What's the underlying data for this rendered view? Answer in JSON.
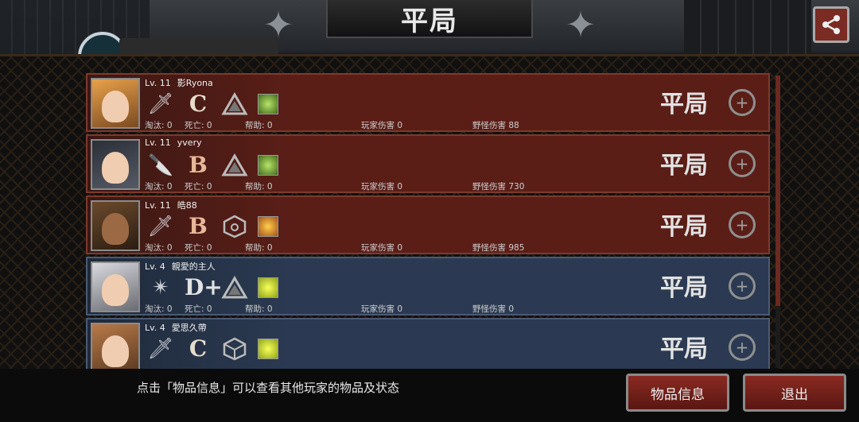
{
  "header": {
    "title": "平局"
  },
  "icons": {
    "share": "share-icon"
  },
  "players": [
    {
      "level": "Lv. 11",
      "name": "影Ryona",
      "weapon": "dagger",
      "grade": "C",
      "result": "平局",
      "eliminations": "淘汰: 0",
      "deaths": "死亡: 0",
      "assists": "帮助: 0",
      "player_damage": "玩家伤害 0",
      "monster_damage": "野怪伤害 88",
      "theme": "red"
    },
    {
      "level": "Lv. 11",
      "name": "yvery",
      "weapon": "knife",
      "grade": "B",
      "result": "平局",
      "eliminations": "淘汰: 0",
      "deaths": "死亡: 0",
      "assists": "帮助: 0",
      "player_damage": "玩家伤害 0",
      "monster_damage": "野怪伤害 730",
      "theme": "red"
    },
    {
      "level": "Lv. 11",
      "name": "皓88",
      "weapon": "dagger",
      "grade": "B",
      "result": "平局",
      "eliminations": "淘汰: 0",
      "deaths": "死亡: 0",
      "assists": "帮助: 0",
      "player_damage": "玩家伤害 0",
      "monster_damage": "野怪伤害 985",
      "theme": "red"
    },
    {
      "level": "Lv. 4",
      "name": "親愛的主人",
      "weapon": "shuriken",
      "grade": "D+",
      "result": "平局",
      "eliminations": "淘汰: 0",
      "deaths": "死亡: 0",
      "assists": "帮助: 0",
      "player_damage": "玩家伤害 0",
      "monster_damage": "野怪伤害 0",
      "theme": "blue"
    },
    {
      "level": "Lv. 4",
      "name": "愛思久帶",
      "weapon": "dagger",
      "grade": "C",
      "result": "平局",
      "eliminations": "",
      "deaths": "",
      "assists": "",
      "player_damage": "",
      "monster_damage": "",
      "theme": "blue"
    }
  ],
  "footer": {
    "hint": "点击「物品信息」可以查看其他玩家的物品及状态",
    "items_button": "物品信息",
    "exit_button": "退出"
  }
}
